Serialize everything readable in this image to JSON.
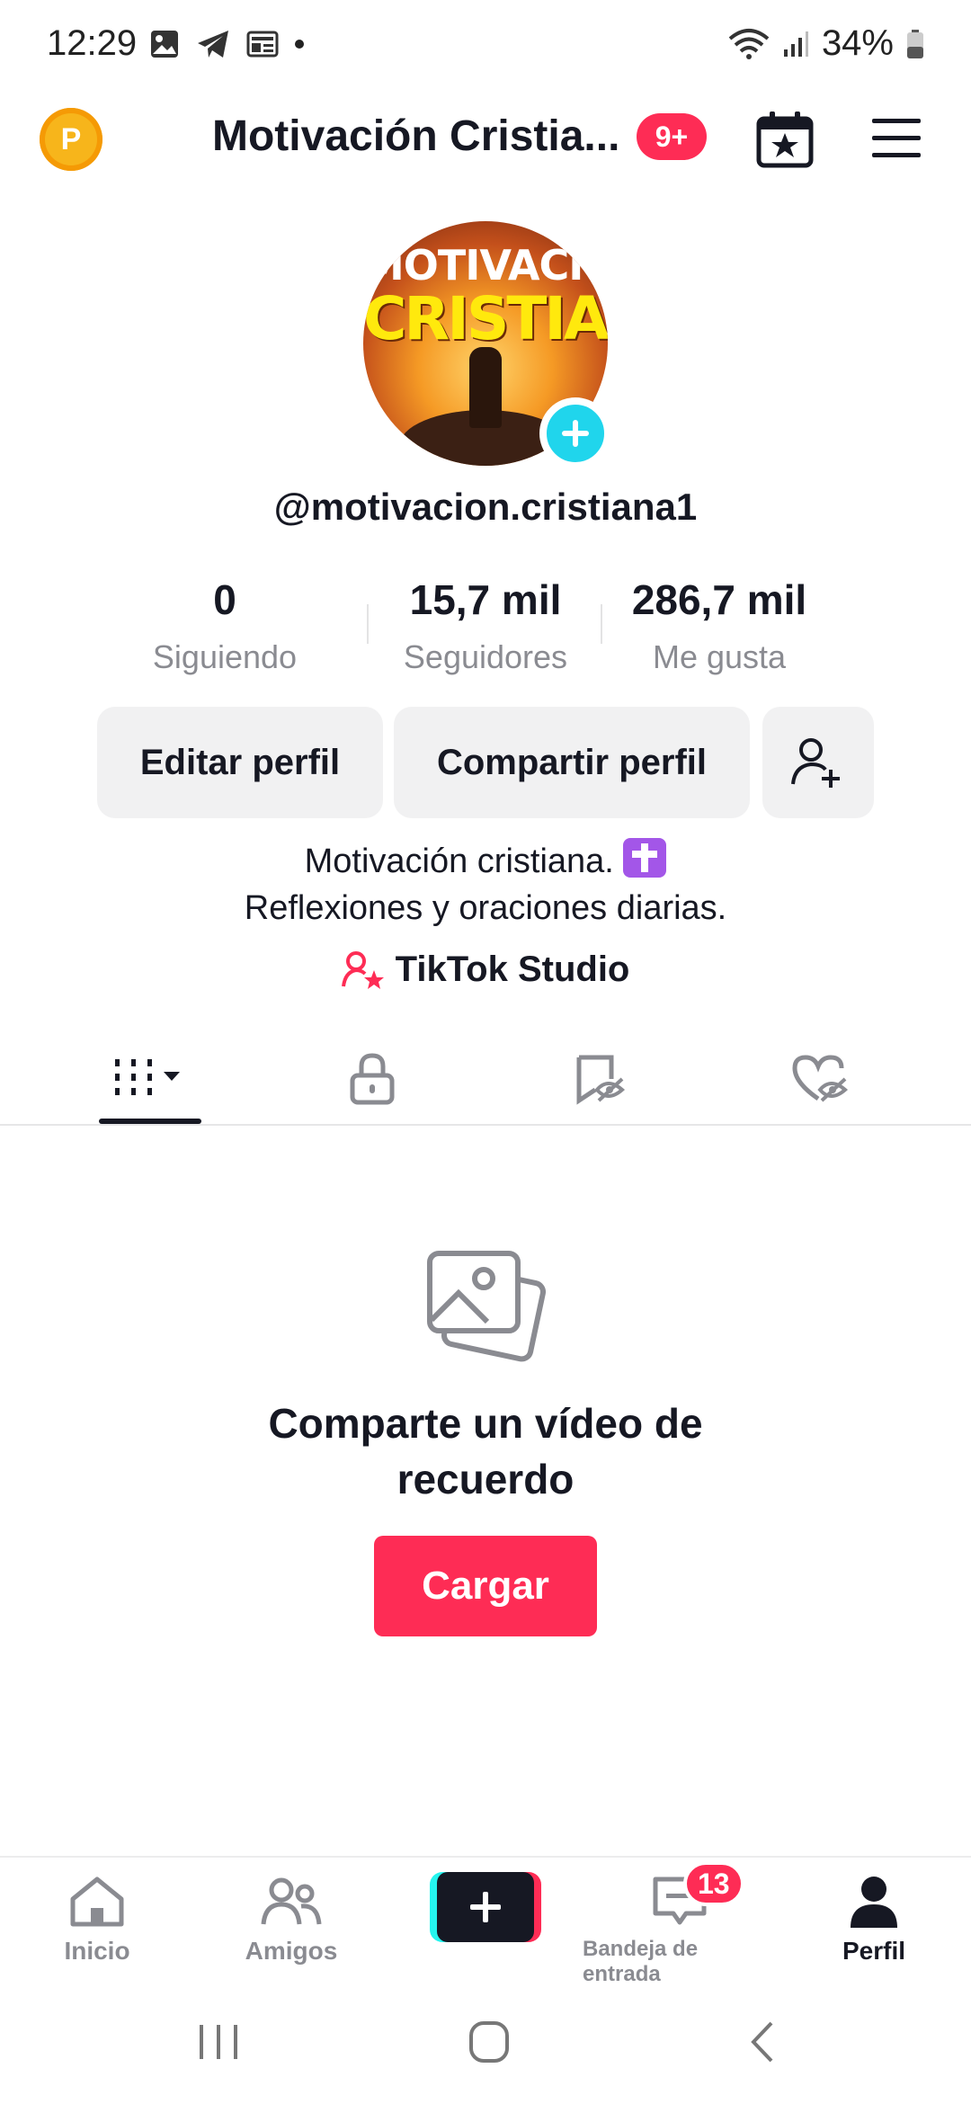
{
  "status_bar": {
    "time": "12:29",
    "battery": "34%"
  },
  "header": {
    "title": "Motivación Cristia...",
    "notifications_badge": "9+",
    "points_label": "P"
  },
  "avatar": {
    "line1": "MOTIVACION",
    "line2": "CRISTIANA"
  },
  "profile": {
    "username": "@motivacion.cristiana1"
  },
  "stats": [
    {
      "value": "0",
      "label": "Siguiendo"
    },
    {
      "value": "15,7 mil",
      "label": "Seguidores"
    },
    {
      "value": "286,7 mil",
      "label": "Me gusta"
    }
  ],
  "actions": {
    "edit": "Editar perfil",
    "share": "Compartir perfil"
  },
  "bio": {
    "line1": "Motivación cristiana.",
    "line2": "Reflexiones y oraciones diarias."
  },
  "studio": {
    "label": "TikTok Studio"
  },
  "empty_state": {
    "title": "Comparte un vídeo de recuerdo",
    "button": "Cargar"
  },
  "bottom_nav": {
    "home": "Inicio",
    "friends": "Amigos",
    "inbox": "Bandeja de entrada",
    "inbox_badge": "13",
    "profile": "Perfil"
  },
  "colors": {
    "accent": "#fe2c55",
    "cyan": "#20d5ec",
    "text": "#161823",
    "muted": "#8a8b91"
  }
}
